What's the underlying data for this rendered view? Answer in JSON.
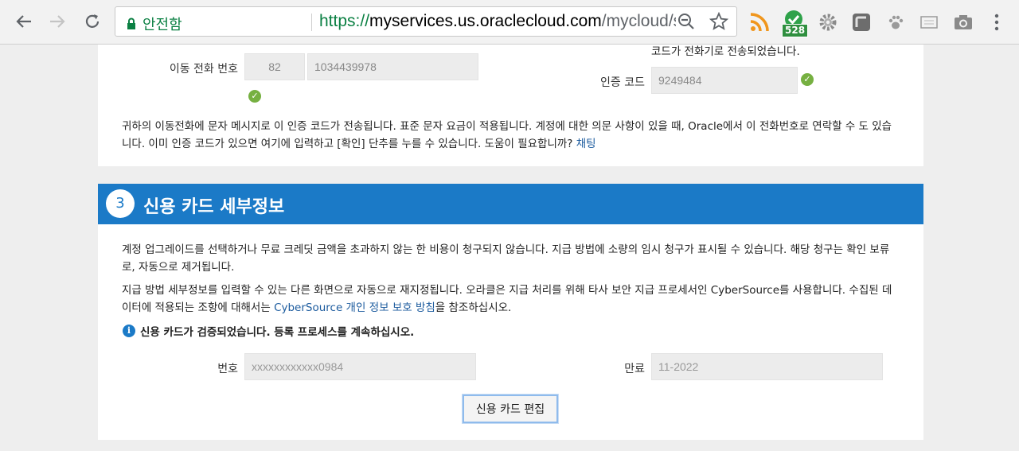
{
  "browser": {
    "secure_label": "안전함",
    "url_scheme": "https://",
    "url_host": "myservices.us.oraclecloud.com",
    "url_path": "/mycloud/signup?l...",
    "extension_badge": "528"
  },
  "phone": {
    "label": "이동 전화 번호",
    "country_code": "82",
    "number": "1034439978",
    "code_sent_msg": "코드가 전화기로 전송되었습니다.",
    "code_label": "인증 코드",
    "code_value": "9249484",
    "info_text": "귀하의 이동전화에 문자 메시지로 이 인증 코드가 전송됩니다. 표준 문자 요금이 적용됩니다. 계정에 대한 의문 사항이 있을 때, Oracle에서 이 전화번호로 연락할 수 도 있습니다. 이미 인증 코드가 있으면 여기에 입력하고 [확인] 단추를 누를 수 있습니다. 도움이 필요합니까?",
    "chat_link": "채팅"
  },
  "credit": {
    "step_number": "3",
    "title": "신용 카드 세부정보",
    "para1": "계정 업그레이드를 선택하거나 무료 크레딧 금액을 초과하지 않는 한 비용이 청구되지 않습니다. 지급 방법에 소량의 임시 청구가 표시될 수 있습니다. 해당 청구는 확인 보류로, 자동으로 제거됩니다.",
    "para2_before": "지급 방법 세부정보를 입력할 수 있는 다른 화면으로 자동으로 재지정됩니다. 오라클은 지급 처리를 위해 타사 보안 지급 프로세서인 CyberSource를 사용합니다. 수집된 데이터에 적용되는 조항에 대해서는",
    "para2_link": "CyberSource 개인 정보 보호 방침",
    "para2_after": "을 참조하십시오.",
    "verified_msg": "신용 카드가 검증되었습니다. 등록 프로세스를 계속하십시오.",
    "number_label": "번호",
    "number_value": "xxxxxxxxxxxx0984",
    "expiry_label": "만료",
    "expiry_value": "11-2022",
    "edit_button": "신용 카드 편집"
  },
  "colors": {
    "header_blue": "#1b7ac7",
    "check_green": "#76b041",
    "link_blue": "#1c5b9e"
  }
}
